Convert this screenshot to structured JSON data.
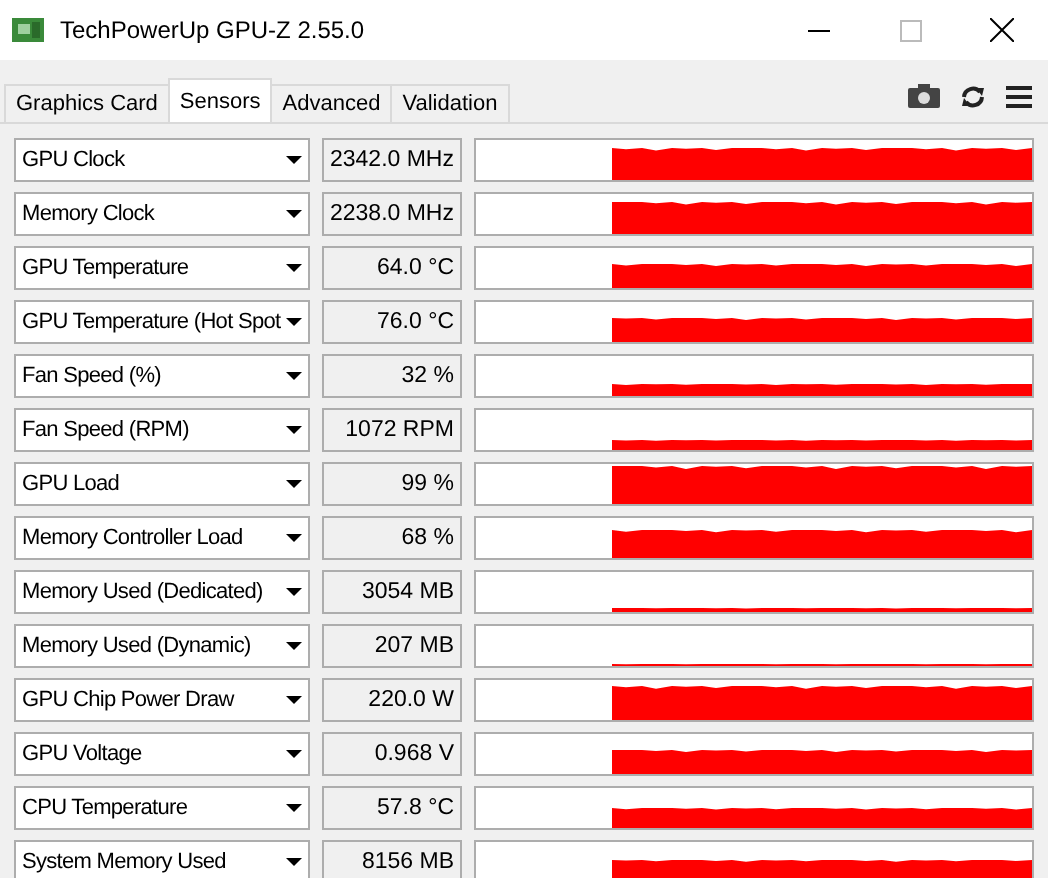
{
  "window": {
    "title": "TechPowerUp GPU-Z 2.55.0"
  },
  "tabs": [
    {
      "label": "Graphics Card",
      "selected": false
    },
    {
      "label": "Sensors",
      "selected": true
    },
    {
      "label": "Advanced",
      "selected": false
    },
    {
      "label": "Validation",
      "selected": false
    }
  ],
  "sensors": [
    {
      "name": "GPU Clock",
      "value": "2342.0 MHz"
    },
    {
      "name": "Memory Clock",
      "value": "2238.0 MHz"
    },
    {
      "name": "GPU Temperature",
      "value": "64.0 °C"
    },
    {
      "name": "GPU Temperature (Hot Spot",
      "value": "76.0 °C"
    },
    {
      "name": "Fan Speed (%)",
      "value": "32 %"
    },
    {
      "name": "Fan Speed (RPM)",
      "value": "1072 RPM"
    },
    {
      "name": "GPU Load",
      "value": "99 %"
    },
    {
      "name": "Memory Controller Load",
      "value": "68 %"
    },
    {
      "name": "Memory Used (Dedicated)",
      "value": "3054 MB"
    },
    {
      "name": "Memory Used (Dynamic)",
      "value": "207 MB"
    },
    {
      "name": "GPU Chip Power Draw",
      "value": "220.0 W"
    },
    {
      "name": "GPU Voltage",
      "value": "0.968 V"
    },
    {
      "name": "CPU Temperature",
      "value": "57.8 °C"
    },
    {
      "name": "System Memory Used",
      "value": "8156 MB"
    }
  ]
}
